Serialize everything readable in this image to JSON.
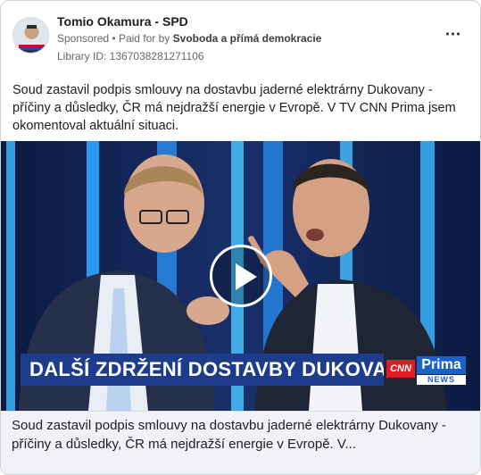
{
  "post": {
    "page_name": "Tomio Okamura - SPD",
    "sponsored_label": "Sponsored",
    "separator": "•",
    "paid_for_label": "Paid for by",
    "paid_for_by": "Svoboda a přímá demokracie",
    "library_id": "Library ID: 1367038281271106",
    "more_icon": "more-options-icon",
    "body_text": "Soud zastavil podpis smlouvy na dostavbu jaderné elektrárny Dukovany - příčiny a důsledky, ČR má nejdražší energie v Evropě. V TV CNN Prima jsem okomentoval aktuální situaci."
  },
  "video": {
    "chyron": "DALŠÍ ZDRŽENÍ DOSTAVBY DUKOVAN",
    "logo_cnn": "CNN",
    "logo_prima": "Prima",
    "logo_news": "NEWS",
    "play_icon": "play-icon",
    "colors": {
      "chyron_bg": "#1d3d8c",
      "cnn_red": "#e21b22",
      "prima_blue": "#1b61c7"
    }
  },
  "caption": {
    "text": "Soud zastavil podpis smlouvy na dostavbu jaderné elektrárny Dukovany - příčiny a důsledky, ČR má nejdražší energie v Evropě. V..."
  }
}
